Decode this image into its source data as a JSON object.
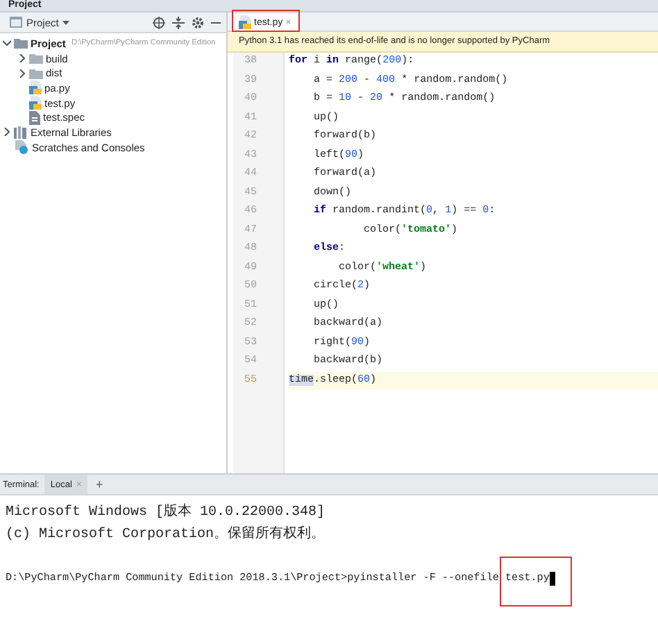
{
  "window": {
    "title": "Project"
  },
  "project_panel": {
    "view_label": "Project",
    "tree": [
      {
        "label": "Project",
        "path": "D:\\PyCharm\\PyCharm Community Edition",
        "kind": "root",
        "expanded": true,
        "children": [
          {
            "label": "build",
            "kind": "folder",
            "expanded": false
          },
          {
            "label": "dist",
            "kind": "folder",
            "expanded": false
          },
          {
            "label": "pa.py",
            "kind": "python"
          },
          {
            "label": "test.py",
            "kind": "python"
          },
          {
            "label": "test.spec",
            "kind": "spec"
          }
        ]
      },
      {
        "label": "External Libraries",
        "kind": "library",
        "expanded": false
      },
      {
        "label": "Scratches and Consoles",
        "kind": "scratch"
      }
    ]
  },
  "editor": {
    "tabs": [
      {
        "label": "test.py",
        "close": "×",
        "selected": true,
        "outlined": true
      }
    ],
    "banner": "Python 3.1 has reached its end-of-life and is no longer supported by PyCharm",
    "lines": [
      {
        "number": "38",
        "current": false,
        "tokens": [
          {
            "kind": "kw",
            "text": "for"
          },
          {
            "kind": "plain",
            "text": " i "
          },
          {
            "kind": "kw",
            "text": "in"
          },
          {
            "kind": "plain",
            "text": " range("
          },
          {
            "kind": "num",
            "text": "200"
          },
          {
            "kind": "plain",
            "text": "):"
          }
        ]
      },
      {
        "number": "39",
        "current": false,
        "tokens": [
          {
            "kind": "plain",
            "text": "    a = "
          },
          {
            "kind": "num",
            "text": "200"
          },
          {
            "kind": "plain",
            "text": " - "
          },
          {
            "kind": "num",
            "text": "400"
          },
          {
            "kind": "plain",
            "text": " * random.random()"
          }
        ]
      },
      {
        "number": "40",
        "current": false,
        "tokens": [
          {
            "kind": "plain",
            "text": "    b = "
          },
          {
            "kind": "num",
            "text": "10"
          },
          {
            "kind": "plain",
            "text": " - "
          },
          {
            "kind": "num",
            "text": "20"
          },
          {
            "kind": "plain",
            "text": " * random.random()"
          }
        ]
      },
      {
        "number": "41",
        "current": false,
        "tokens": [
          {
            "kind": "plain",
            "text": "    up()"
          }
        ]
      },
      {
        "number": "42",
        "current": false,
        "tokens": [
          {
            "kind": "plain",
            "text": "    forward(b)"
          }
        ]
      },
      {
        "number": "43",
        "current": false,
        "tokens": [
          {
            "kind": "plain",
            "text": "    left("
          },
          {
            "kind": "num",
            "text": "90"
          },
          {
            "kind": "plain",
            "text": ")"
          }
        ]
      },
      {
        "number": "44",
        "current": false,
        "tokens": [
          {
            "kind": "plain",
            "text": "    forward(a)"
          }
        ]
      },
      {
        "number": "45",
        "current": false,
        "tokens": [
          {
            "kind": "plain",
            "text": "    down()"
          }
        ]
      },
      {
        "number": "46",
        "current": false,
        "tokens": [
          {
            "kind": "kw",
            "text": "    if"
          },
          {
            "kind": "plain",
            "text": " random.randint("
          },
          {
            "kind": "num",
            "text": "0"
          },
          {
            "kind": "plain",
            "text": ", "
          },
          {
            "kind": "num",
            "text": "1"
          },
          {
            "kind": "plain",
            "text": ") == "
          },
          {
            "kind": "num",
            "text": "0"
          },
          {
            "kind": "plain",
            "text": ":"
          }
        ]
      },
      {
        "number": "47",
        "current": false,
        "tokens": [
          {
            "kind": "plain",
            "text": "            color("
          },
          {
            "kind": "str",
            "text": "'tomato'"
          },
          {
            "kind": "plain",
            "text": ")"
          }
        ]
      },
      {
        "number": "48",
        "current": false,
        "tokens": [
          {
            "kind": "kw",
            "text": "    else"
          },
          {
            "kind": "plain",
            "text": ":"
          }
        ]
      },
      {
        "number": "49",
        "current": false,
        "tokens": [
          {
            "kind": "plain",
            "text": "        color("
          },
          {
            "kind": "str",
            "text": "'wheat'"
          },
          {
            "kind": "plain",
            "text": ")"
          }
        ]
      },
      {
        "number": "50",
        "current": false,
        "tokens": [
          {
            "kind": "plain",
            "text": "    circle("
          },
          {
            "kind": "num",
            "text": "2"
          },
          {
            "kind": "plain",
            "text": ")"
          }
        ]
      },
      {
        "number": "51",
        "current": false,
        "tokens": [
          {
            "kind": "plain",
            "text": "    up()"
          }
        ]
      },
      {
        "number": "52",
        "current": false,
        "tokens": [
          {
            "kind": "plain",
            "text": "    backward(a)"
          }
        ]
      },
      {
        "number": "53",
        "current": false,
        "tokens": [
          {
            "kind": "plain",
            "text": "    right("
          },
          {
            "kind": "num",
            "text": "90"
          },
          {
            "kind": "plain",
            "text": ")"
          }
        ]
      },
      {
        "number": "54",
        "current": false,
        "tokens": [
          {
            "kind": "plain",
            "text": "    backward(b)"
          }
        ]
      },
      {
        "number": "55",
        "current": true,
        "tokens": [
          {
            "kind": "sel",
            "text": "time"
          },
          {
            "kind": "plain",
            "text": ".sleep("
          },
          {
            "kind": "num",
            "text": "60"
          },
          {
            "kind": "plain",
            "text": ")"
          }
        ]
      }
    ]
  },
  "terminal": {
    "title": "Terminal:",
    "tabs": [
      {
        "label": "Local",
        "close": "×",
        "selected": true
      }
    ],
    "add": "+",
    "lines": [
      {
        "kind": "output",
        "text": "Microsoft Windows [版本 10.0.22000.348]"
      },
      {
        "kind": "output",
        "text": "(c) Microsoft Corporation。保留所有权利。"
      },
      {
        "kind": "prompt",
        "text": "D:\\PyCharm\\PyCharm Community Edition 2018.3.1\\Project>pyinstaller -F --onefile test.py",
        "cursor": true,
        "outlined": true
      }
    ]
  }
}
